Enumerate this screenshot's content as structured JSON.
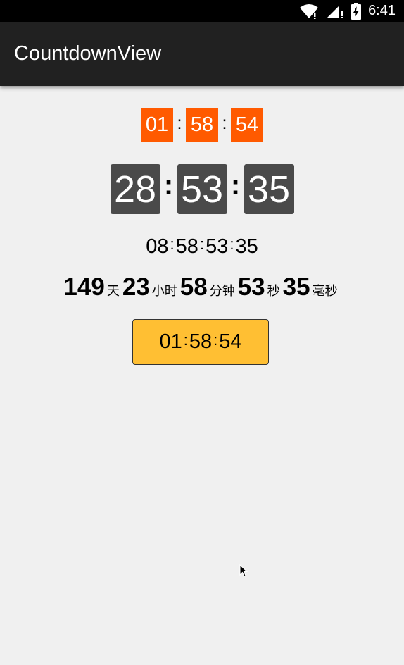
{
  "status_bar": {
    "time": "6:41"
  },
  "app_bar": {
    "title": "CountdownView"
  },
  "countdowns": {
    "orange": {
      "h": "01",
      "m": "58",
      "s": "54",
      "sep": ":"
    },
    "gray": {
      "a": "28",
      "b": "53",
      "c": "35",
      "sep": ":"
    },
    "plain": {
      "a": "08",
      "b": "58",
      "c": "53",
      "d": "35",
      "sep": ":"
    },
    "units": {
      "day": "149",
      "day_unit": "天",
      "hour": "23",
      "hour_unit": "小时",
      "minute": "58",
      "minute_unit": "分钟",
      "second": "53",
      "second_unit": "秒",
      "ms": "35",
      "ms_unit": "毫秒"
    },
    "button": {
      "h": "01",
      "m": "58",
      "s": "54",
      "sep": ":"
    }
  },
  "colors": {
    "orange": "#ff5a00",
    "gray_box": "#4a4a4a",
    "yellow": "#ffbf33",
    "app_bar": "#212121"
  }
}
